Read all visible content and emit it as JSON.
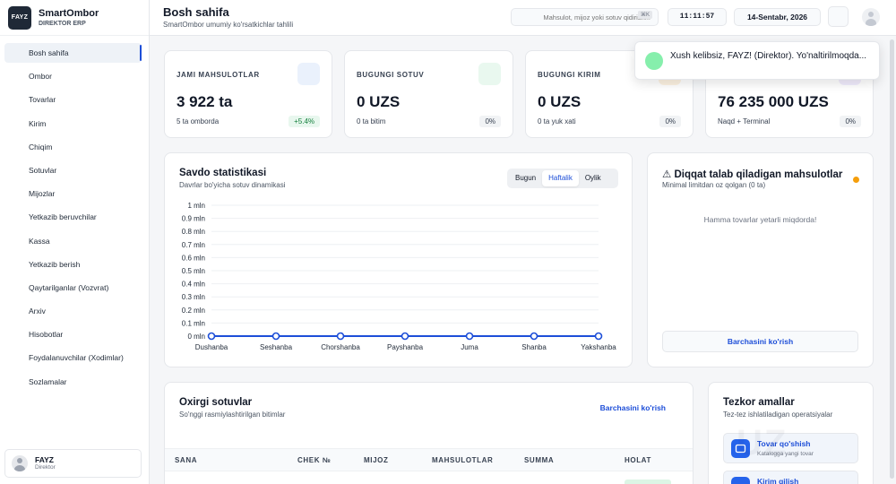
{
  "brand": {
    "logo_text": "FAYZ",
    "name": "SmartOmbor",
    "sub": "DIREKTOR ERP"
  },
  "sidebar": {
    "items": [
      {
        "label": "Bosh sahifa",
        "active": true
      },
      {
        "label": "Ombor"
      },
      {
        "label": "Tovarlar"
      },
      {
        "label": "Kirim"
      },
      {
        "label": "Chiqim"
      },
      {
        "label": "Sotuvlar"
      },
      {
        "label": "Mijozlar"
      },
      {
        "label": "Yetkazib beruvchilar"
      },
      {
        "label": "Kassa"
      },
      {
        "label": "Yetkazib berish"
      },
      {
        "label": "Qaytarilganlar (Vozvrat)"
      },
      {
        "label": "Arxiv"
      },
      {
        "label": "Hisobotlar"
      },
      {
        "label": "Foydalanuvchilar (Xodimlar)"
      },
      {
        "label": "Sozlamalar"
      }
    ],
    "user": {
      "name": "FAYZ",
      "role": "Direktor"
    }
  },
  "header": {
    "title": "Bosh sahifa",
    "subtitle": "SmartOmbor umumiy ko'rsatkichlar tahlili",
    "search_placeholder": "Mahsulot, mijoz yoki sotuv qidirish...",
    "search_shortcut": "⌘K",
    "time": "11:11:57",
    "date": "14-Sentabr, 2026"
  },
  "stats": [
    {
      "label": "JAMI MAHSULOTLAR",
      "value": "3 922 ta",
      "sub": "5 ta omborda",
      "badge": "+5.4%",
      "badge_up": true,
      "icon_color": "#eaf1fc",
      "icon": "box-icon"
    },
    {
      "label": "BUGUNGI SOTUV",
      "value": "0 UZS",
      "sub": "0 ta bitim",
      "badge": "0%",
      "icon_color": "#e9f8ef",
      "icon": "cart-icon"
    },
    {
      "label": "BUGUNGI KIRIM",
      "value": "0 UZS",
      "sub": "0 ta yuk xati",
      "badge": "0%",
      "icon_color": "#fdf3e2",
      "icon": "download-icon"
    },
    {
      "label": "",
      "value": "76 235 000 UZS",
      "sub": "Naqd + Terminal",
      "badge": "0%",
      "icon_color": "#f1ecfc",
      "icon": "wallet-icon"
    }
  ],
  "sales": {
    "title": "Savdo statistikasi",
    "subtitle": "Davrlar bo'yicha sotuv dinamikasi",
    "tabs": [
      "Bugun",
      "Haftalik",
      "Oylik"
    ],
    "active_tab": 1
  },
  "chart_data": {
    "type": "line",
    "categories": [
      "Dushanba",
      "Seshanba",
      "Chorshanba",
      "Payshanba",
      "Juma",
      "Shanba",
      "Yakshanba"
    ],
    "values": [
      0,
      0,
      0,
      0,
      0,
      0,
      0
    ],
    "ylim": [
      0,
      1000000
    ],
    "yticks": [
      0,
      100000,
      200000,
      300000,
      400000,
      500000,
      600000,
      700000,
      800000,
      900000,
      1000000
    ],
    "yticklabels": [
      "0 mln",
      "0.1 mln",
      "0.2 mln",
      "0.3 mln",
      "0.4 mln",
      "0.5 mln",
      "0.6 mln",
      "0.7 mln",
      "0.8 mln",
      "0.9 mln",
      "1 mln"
    ],
    "grid": true,
    "color": "#1d4ed8"
  },
  "attention": {
    "title": "⚠ Diqqat talab qiladigan mahsulotlar",
    "subtitle": "Minimal limitdan oz qolgan (0 ta)",
    "empty": "Hamma tovarlar yetarli miqdorda!",
    "button": "Barchasini ko'rish"
  },
  "recent": {
    "title": "Oxirgi sotuvlar",
    "subtitle": "So'nggi rasmiylashtirilgan bitimlar",
    "link": "Barchasini ko'rish",
    "columns": [
      "SANA",
      "CHEK №",
      "MIJOZ",
      "MAHSULOTLAR",
      "SUMMA",
      "HOLAT"
    ]
  },
  "quick": {
    "title": "Tezkor amallar",
    "subtitle": "Tez-tez ishlatiladigan operatsiyalar",
    "items": [
      {
        "label": "Tovar qo'shish",
        "sub": "Katalogga yangi tovar"
      },
      {
        "label": "Kirim qilish",
        "sub": ""
      }
    ]
  },
  "watermark": "UZ",
  "toast": {
    "message": "Xush kelibsiz, FAYZ! (Direktor). Yo'naltirilmoqda..."
  }
}
